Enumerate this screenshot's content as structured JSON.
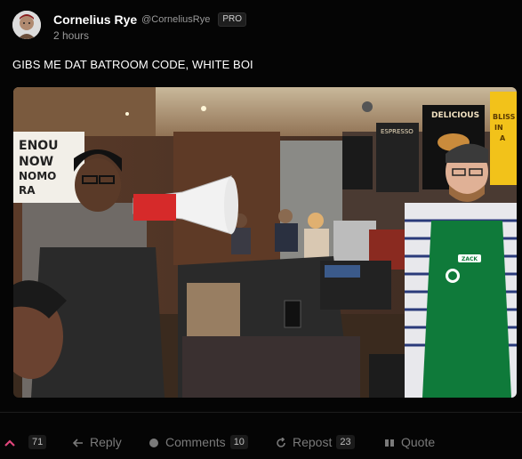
{
  "post": {
    "author": {
      "display_name": "Cornelius Rye",
      "handle": "@CorneliusRye",
      "badge": "PRO",
      "avatar_icon": "avatar-portrait-icon"
    },
    "timestamp": "2 hours",
    "text": "GIBS ME DAT BATROOM CODE, WHITE BOI",
    "image": {
      "sign_text": [
        "ENOU",
        "NOW",
        "NOMO",
        "RA"
      ],
      "menu_board_text": [
        "DELICIOUS",
        "ESPRESSO"
      ],
      "side_sign_text": [
        "BLISS",
        "IN",
        "A"
      ],
      "name_tag": "ZACK"
    }
  },
  "actions": {
    "upvote": {
      "icon": "chevron-up-icon",
      "count": "71"
    },
    "reply": {
      "icon": "reply-arrow-icon",
      "label": "Reply"
    },
    "comments": {
      "icon": "comment-bubble-icon",
      "label": "Comments",
      "count": "10"
    },
    "repost": {
      "icon": "repost-icon",
      "label": "Repost",
      "count": "23"
    },
    "quote": {
      "icon": "quote-icon",
      "label": "Quote"
    }
  },
  "colors": {
    "background": "#050505",
    "upvote_accent": "#e0457b",
    "muted_text": "#7a7a7a",
    "apron_green": "#0f7a3a"
  }
}
